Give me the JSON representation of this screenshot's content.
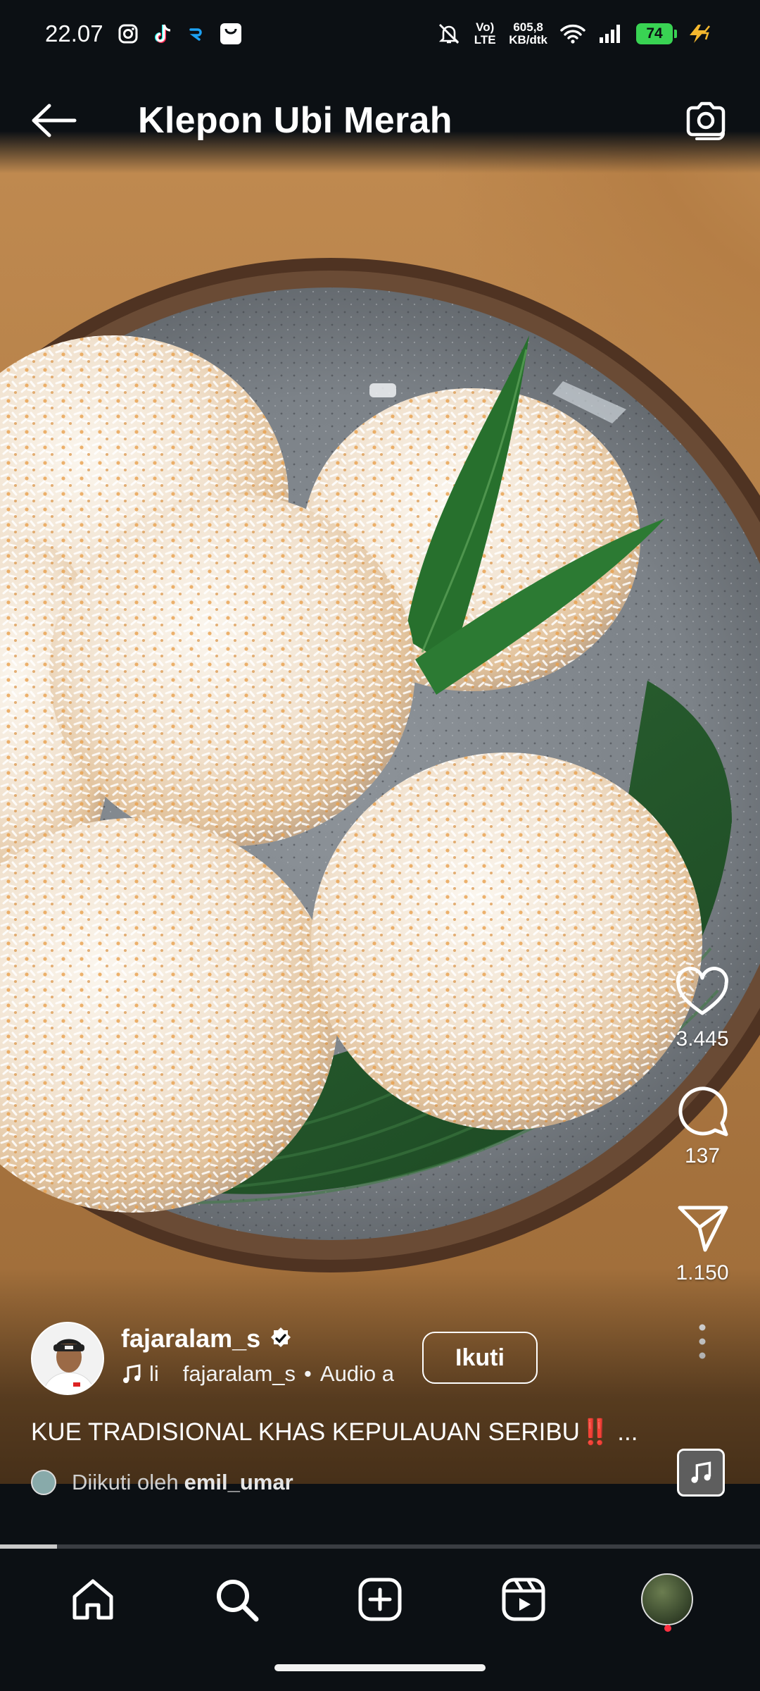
{
  "status_bar": {
    "time": "22.07",
    "app_icons": [
      "instagram-icon",
      "tiktok-icon",
      "app-icon",
      "shopping-bag-icon"
    ],
    "volte": "Vo) LTE",
    "data_speed_value": "605,8",
    "data_speed_unit": "KB/dtk",
    "battery": "74",
    "icons": [
      "mute-icon",
      "wifi-icon",
      "signal-icon",
      "battery-icon",
      "charging-icon"
    ]
  },
  "header": {
    "title": "Klepon Ubi Merah",
    "back_icon": "arrow-left-icon",
    "camera_icon": "camera-icon"
  },
  "actions": {
    "likes": "3.445",
    "comments": "137",
    "shares": "1.150"
  },
  "post": {
    "username": "fajaralam_s",
    "verified": true,
    "audio_prefix": "li",
    "audio_owner": "fajaralam_s",
    "audio_separator": "•",
    "audio_label": "Audio a",
    "follow_label": "Ikuti",
    "caption": "KUE TRADISIONAL KHAS KEPULAUAN SERIBU",
    "caption_emoji": "‼️",
    "caption_more": "...",
    "followed_by_prefix": "Diikuti oleh",
    "followed_by_user": "emil_umar"
  },
  "progress": {
    "fraction": 0.075
  },
  "nav": {
    "items": [
      "home-icon",
      "search-icon",
      "create-icon",
      "reels-icon",
      "profile-avatar"
    ]
  },
  "colors": {
    "background": "#0c1014",
    "accent_red": "#ff3040",
    "battery_green": "#39d353"
  }
}
